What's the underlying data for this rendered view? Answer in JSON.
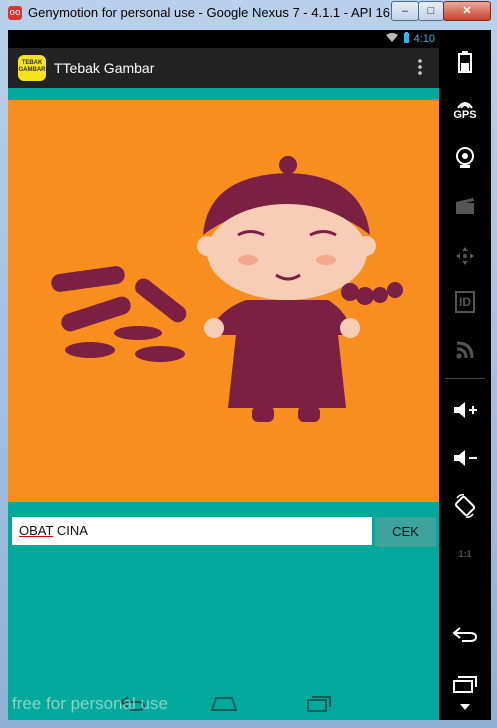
{
  "window": {
    "title": "Genymotion for personal use - Google Nexus 7 - 4.1.1 - API 16 - ...",
    "icon_text": "oo",
    "min_label": "–",
    "max_label": "□",
    "close_label": "✕"
  },
  "statusbar": {
    "time": "4:10"
  },
  "app": {
    "logo_text": "TEBAK GAMBAR",
    "title": "TTebak Gambar",
    "answer_prefix": "OBAT",
    "answer_rest": " CINA",
    "check_label": "CEK"
  },
  "watermark": "free for personal use",
  "sidebar": {
    "gps_label": "GPS",
    "id_label": "ID",
    "ratio_label": "1:1"
  },
  "colors": {
    "picture_bg": "#f78e1e",
    "figure": "#7b1f43",
    "teal": "#00a99c"
  }
}
